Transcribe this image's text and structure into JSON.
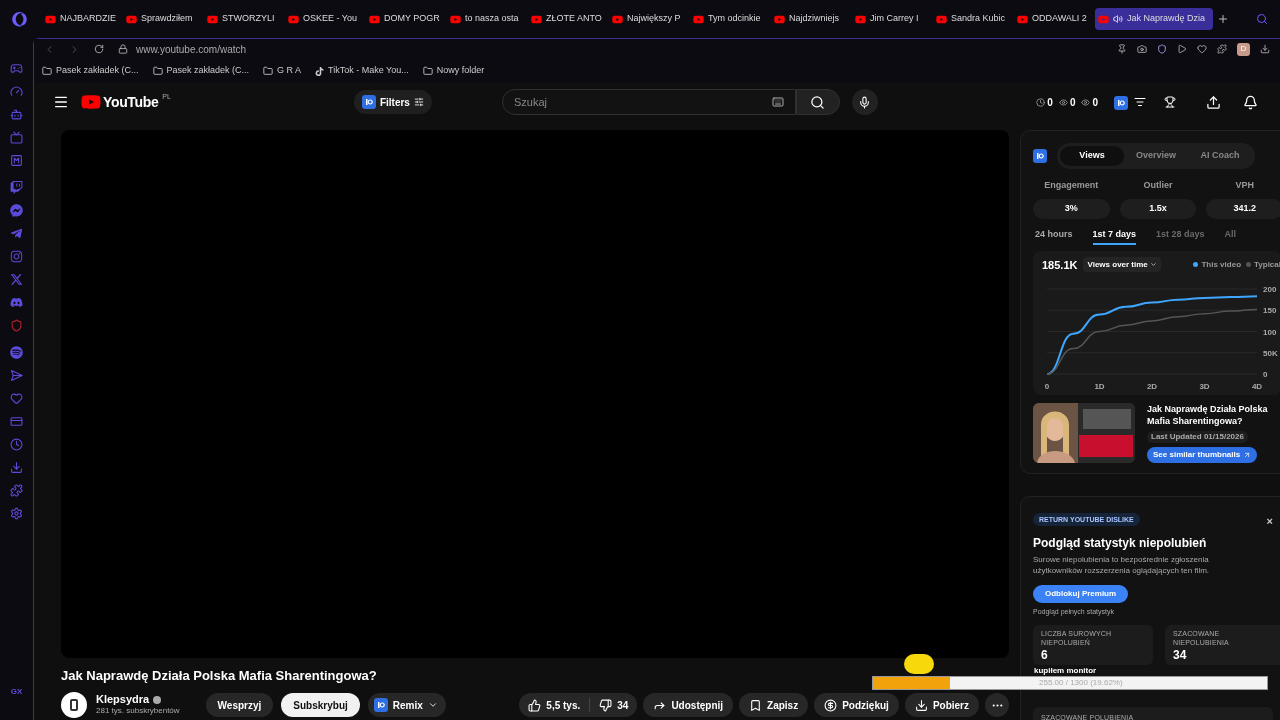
{
  "browser": {
    "tabs": [
      {
        "title": "NAJBARDZIE",
        "selected": false
      },
      {
        "title": "Sprawdziłem",
        "selected": false
      },
      {
        "title": "STWORZYLI",
        "selected": false
      },
      {
        "title": "OSKEE - You",
        "selected": false
      },
      {
        "title": "DOMY POGR",
        "selected": false
      },
      {
        "title": "to nasza osta",
        "selected": false
      },
      {
        "title": "ZŁOTE ANTO",
        "selected": false
      },
      {
        "title": "Największy P",
        "selected": false
      },
      {
        "title": "Tym odcinkie",
        "selected": false
      },
      {
        "title": "Najdziwniejs",
        "selected": false
      },
      {
        "title": "Jim Carrey I",
        "selected": false
      },
      {
        "title": "Sandra Kubic",
        "selected": false
      },
      {
        "title": "ODDAWALI 2",
        "selected": false
      },
      {
        "title": "Jak Naprawdę Dzia",
        "selected": true
      }
    ],
    "url": "www.youtube.com/watch",
    "profile": "D",
    "bookmarks": [
      {
        "label": "Pasek zakładek (C...",
        "kind": "folder"
      },
      {
        "label": "Pasek zakładek (C...",
        "kind": "folder"
      },
      {
        "label": "G R A",
        "kind": "folder"
      },
      {
        "label": "TikTok - Make You...",
        "kind": "tiktok"
      },
      {
        "label": "Nowy folder",
        "kind": "folder"
      }
    ],
    "sidebar_footer": "GX"
  },
  "youtube": {
    "logo": "YouTube",
    "region": "PL",
    "filters": "Filters",
    "search": {
      "placeholder": "Szukaj"
    },
    "counters": [
      "0",
      "0",
      "0"
    ]
  },
  "video": {
    "title": "Jak Naprawdę Działa Polska Mafia Sharentingowa?",
    "channel": "Klepsydra",
    "subscribers": "281 tys. subskrybentów",
    "support": "Wesprzyj",
    "subscribe": "Subskrybuj",
    "remix": "Remix",
    "likes": "5,5 tys.",
    "dislikes": "34",
    "share": "Udostępnij",
    "save": "Zapisz",
    "thanks": "Podziękuj",
    "download": "Pobierz"
  },
  "vidiq": {
    "tabs": [
      {
        "label": "Views",
        "selected": true
      },
      {
        "label": "Overview",
        "selected": false
      },
      {
        "label": "AI Coach",
        "selected": false
      }
    ],
    "stats": [
      {
        "label": "Engagement",
        "value": "3%"
      },
      {
        "label": "Outlier",
        "value": "1.5x"
      },
      {
        "label": "VPH",
        "value": "341.2"
      }
    ],
    "periods": [
      {
        "label": "24 hours",
        "selected": false,
        "disabled": false
      },
      {
        "label": "1st 7 days",
        "selected": true,
        "disabled": false
      },
      {
        "label": "1st 28 days",
        "selected": false,
        "disabled": true
      },
      {
        "label": "All",
        "selected": false,
        "disabled": true
      }
    ],
    "total": "185.1K",
    "metric": "Views over time",
    "chart_data": {
      "type": "line",
      "x": [
        0,
        0.5,
        1,
        1.5,
        2,
        2.5,
        3,
        3.5,
        4
      ],
      "series": [
        {
          "name": "This video",
          "color": "#3ea6ff",
          "values": [
            0,
            95,
            140,
            158,
            168,
            175,
            179,
            181,
            183
          ]
        },
        {
          "name": "Typical",
          "color": "#555555",
          "values": [
            0,
            60,
            100,
            115,
            125,
            135,
            142,
            148,
            152
          ]
        }
      ],
      "xlim": [
        0,
        4
      ],
      "ylim": [
        0,
        200
      ],
      "grid": true,
      "xticks": [
        0,
        {
          "value": 1,
          "label": "1D"
        },
        {
          "value": 2,
          "label": "2D"
        },
        {
          "value": 3,
          "label": "3D"
        },
        {
          "value": 4,
          "label": "4D"
        }
      ],
      "yticks": [
        0,
        {
          "value": 50,
          "label": "50K"
        },
        100,
        150,
        200
      ]
    },
    "thumb": {
      "kind": "picture",
      "title": "Jak Naprawdę Działa Polska Mafia Sharentingowa?",
      "updated": "Last Updated 01/15/2026",
      "button": "See similar thumbnails"
    }
  },
  "dislike": {
    "badge": "RETURN YOUTUBE DISLIKE",
    "close": "×",
    "title": "Podgląd statystyk niepolubień",
    "description": "Surowe niepolubienia to bezpośrednie zgłoszenia użytkowników rozszerzenia oglądających ten film.",
    "button": "Odblokuj Premium",
    "note": "Podgląd pełnych statystyk",
    "cards": [
      {
        "label": "LICZBA SUROWYCH NIEPOLUBIEŃ",
        "value": "6"
      },
      {
        "label": "SZACOWANE NIEPOLUBIENIA",
        "value": "34"
      }
    ],
    "more": "SZACOWANE POLUBIENIA"
  },
  "overlay": {
    "caption": "kupiłem monitor",
    "progress": {
      "text": "255.00 / 1300 (19.62%)",
      "level": 0.1962
    }
  }
}
